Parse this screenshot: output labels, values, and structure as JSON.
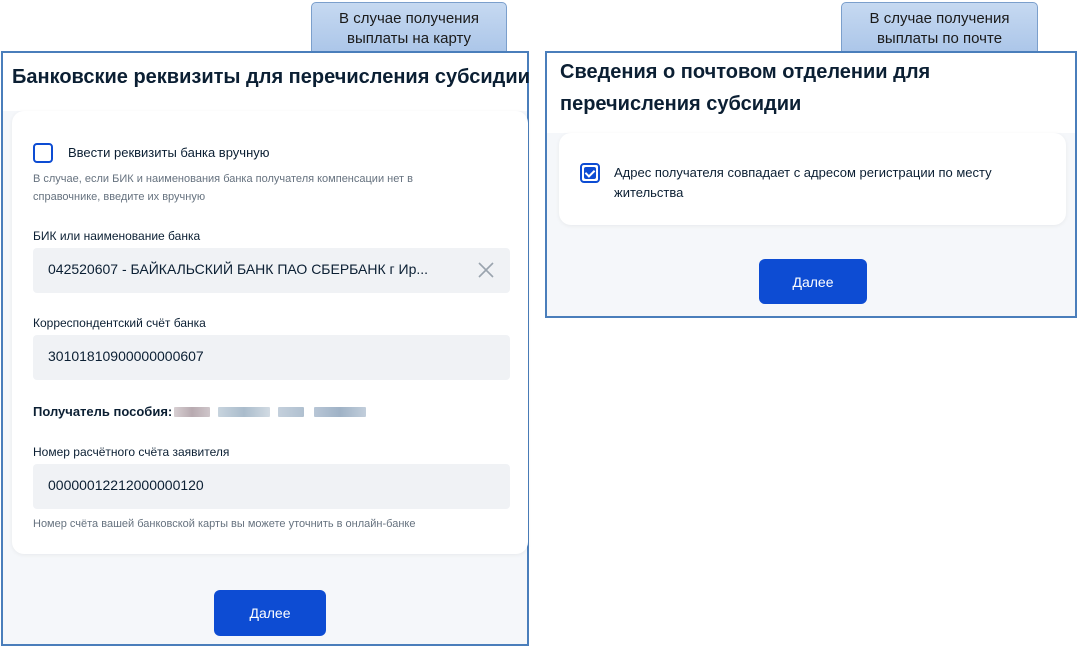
{
  "callouts": {
    "card_payment": "В случае получения выплаты на карту",
    "postal_payment": "В случае получения выплаты по почте"
  },
  "bank_form": {
    "title": "Банковские реквизиты для перечисления субсидии",
    "manual_checkbox": {
      "label": "Ввести реквизиты банка вручную",
      "checked": false,
      "hint": "В случае, если БИК и наименования банка получателя компенсации нет в справочнике, введите их вручную"
    },
    "bik_field": {
      "label": "БИК или наименование банка",
      "value": "042520607 - БАЙКАЛЬСКИЙ БАНК ПАО СБЕРБАНК г Ир..."
    },
    "corr_account_field": {
      "label": "Корреспондентский счёт банка",
      "value": "30101810900000000607"
    },
    "recipient": {
      "label": "Получатель пособия:"
    },
    "account_field": {
      "label": "Номер расчётного счёта заявителя",
      "value": "00000012212000000120",
      "hint": "Номер счёта вашей банковской карты вы можете уточнить в онлайн-банке"
    },
    "next_button": "Далее"
  },
  "postal_form": {
    "title": "Сведения о почтовом отделении для перечисления субсидии",
    "address_checkbox": {
      "label": "Адрес получателя совпадает с адресом регистрации по месту жительства",
      "checked": true
    },
    "next_button": "Далее"
  },
  "colors": {
    "accent": "#0d4cd3",
    "frame": "#4a7ebb",
    "input_bg": "#f0f2f5",
    "hint_text": "#66727f"
  },
  "icons": {
    "clear": "close-icon",
    "checkbox_checked": "check-icon"
  }
}
